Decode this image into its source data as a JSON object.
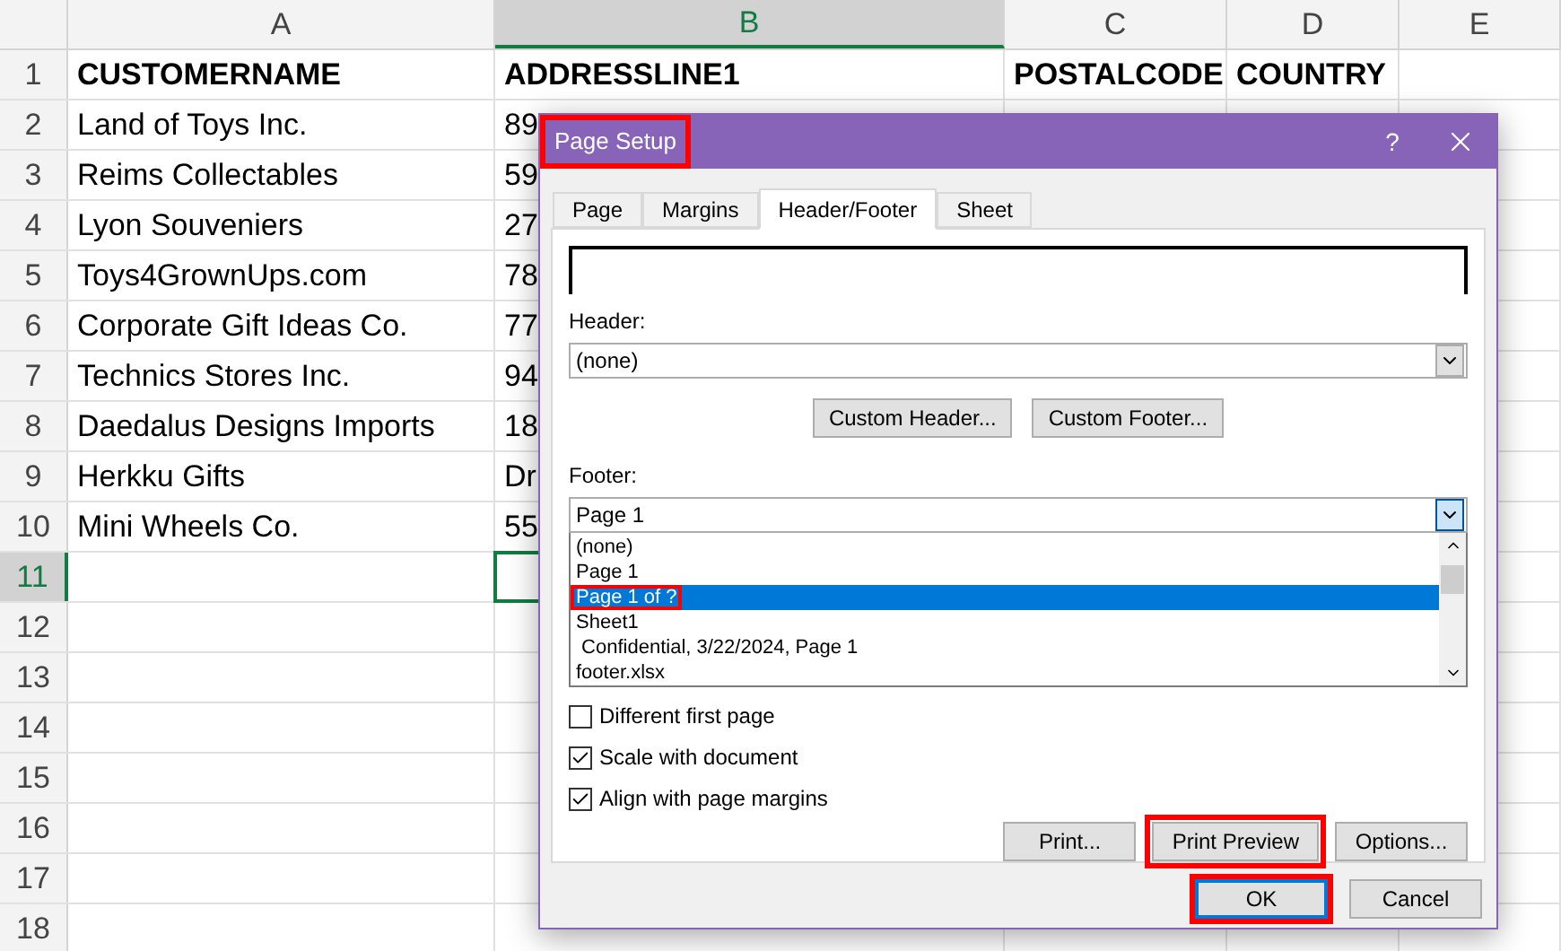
{
  "spreadsheet": {
    "columns": [
      {
        "label": "A",
        "selected": false
      },
      {
        "label": "B",
        "selected": true
      },
      {
        "label": "C",
        "selected": false
      },
      {
        "label": "D",
        "selected": false
      },
      {
        "label": "E",
        "selected": false
      }
    ],
    "rows": [
      {
        "number": "1",
        "kind": "header",
        "selected": false,
        "cells": [
          "CUSTOMERNAME",
          "ADDRESSLINE1",
          "POSTALCODE",
          "COUNTRY"
        ]
      },
      {
        "number": "2",
        "kind": "data",
        "selected": false,
        "cells": [
          "Land of Toys Inc.",
          "89"
        ]
      },
      {
        "number": "3",
        "kind": "data",
        "selected": false,
        "cells": [
          "Reims Collectables",
          "59"
        ]
      },
      {
        "number": "4",
        "kind": "data",
        "selected": false,
        "cells": [
          "Lyon Souveniers",
          "27"
        ]
      },
      {
        "number": "5",
        "kind": "data",
        "selected": false,
        "cells": [
          "Toys4GrownUps.com",
          "78"
        ]
      },
      {
        "number": "6",
        "kind": "data",
        "selected": false,
        "cells": [
          "Corporate Gift Ideas Co.",
          "77"
        ]
      },
      {
        "number": "7",
        "kind": "data",
        "selected": false,
        "cells": [
          "Technics Stores Inc.",
          "94"
        ]
      },
      {
        "number": "8",
        "kind": "data",
        "selected": false,
        "cells": [
          "Daedalus Designs Imports",
          "18"
        ]
      },
      {
        "number": "9",
        "kind": "data",
        "selected": false,
        "cells": [
          "Herkku Gifts",
          "Dr"
        ]
      },
      {
        "number": "10",
        "kind": "data",
        "selected": false,
        "cells": [
          "Mini Wheels Co.",
          "55"
        ]
      },
      {
        "number": "11",
        "selected": true
      },
      {
        "number": "12",
        "selected": false
      },
      {
        "number": "13",
        "selected": false
      },
      {
        "number": "14",
        "selected": false
      },
      {
        "number": "15",
        "selected": false
      },
      {
        "number": "16",
        "selected": false
      },
      {
        "number": "17",
        "selected": false
      },
      {
        "number": "18",
        "selected": false
      }
    ]
  },
  "dialog": {
    "title": "Page Setup",
    "title_annotated": true,
    "help": "?",
    "tabs": [
      {
        "label": "Page",
        "selected": false
      },
      {
        "label": "Margins",
        "selected": false
      },
      {
        "label": "Header/Footer",
        "selected": true
      },
      {
        "label": "Sheet",
        "selected": false
      }
    ],
    "header_label": "Header:",
    "header_value": "(none)",
    "custom_buttons": [
      "Custom Header...",
      "Custom Footer..."
    ],
    "footer_label": "Footer:",
    "footer_value": "Page 1",
    "footer_options": [
      {
        "label": "(none)",
        "selected": false,
        "annotated": false
      },
      {
        "label": "Page 1",
        "selected": false,
        "annotated": false
      },
      {
        "label": "Page 1 of ?",
        "selected": true,
        "annotated": true
      },
      {
        "label": "Sheet1",
        "selected": false,
        "annotated": false
      },
      {
        "label": " Confidential, 3/22/2024, Page 1",
        "selected": false,
        "annotated": false
      },
      {
        "label": "footer.xlsx",
        "selected": false,
        "annotated": false
      }
    ],
    "checkboxes": [
      {
        "label": "Different first page",
        "checked": false
      },
      {
        "label": "Scale with document",
        "checked": true
      },
      {
        "label": "Align with page margins",
        "checked": true
      }
    ],
    "panel_buttons": [
      {
        "label": "Print...",
        "annotated": false
      },
      {
        "label": "Print Preview",
        "annotated": true
      },
      {
        "label": "Options...",
        "annotated": false
      }
    ],
    "footer_buttons": [
      {
        "label": "OK",
        "annotated": true,
        "default": true
      },
      {
        "label": "Cancel",
        "annotated": false,
        "default": false
      }
    ]
  }
}
